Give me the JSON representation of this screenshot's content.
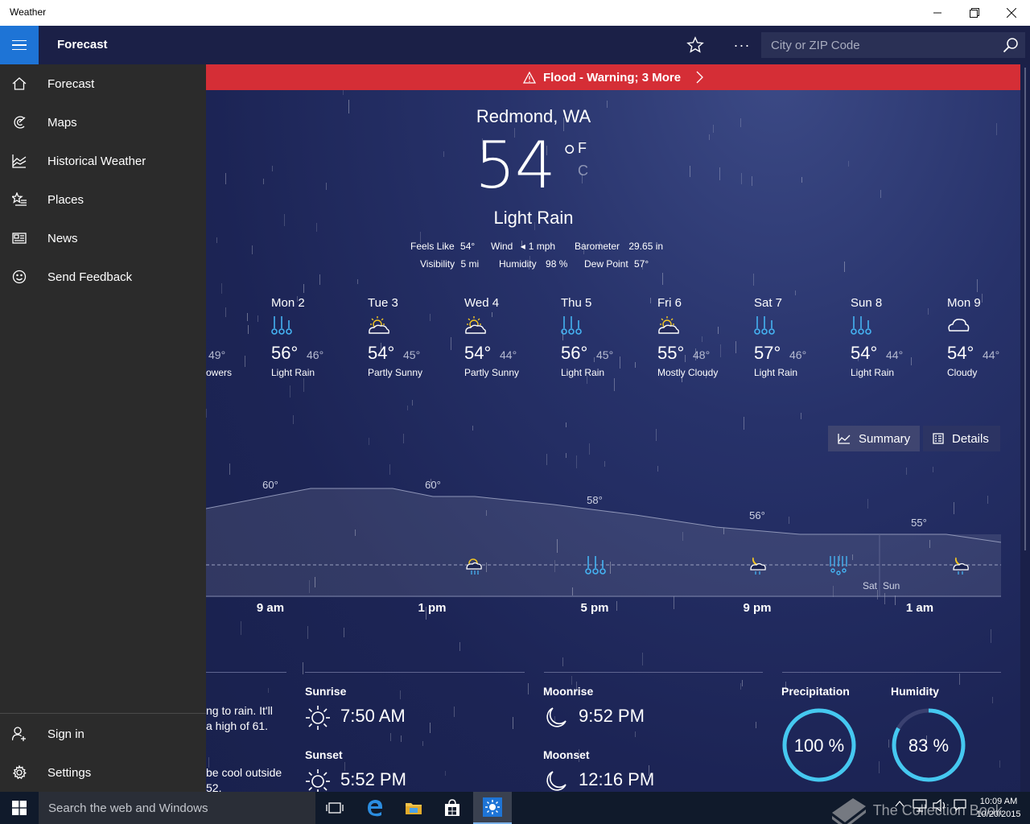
{
  "window": {
    "title": "Weather"
  },
  "appbar": {
    "section_title": "Forecast",
    "search_placeholder": "City or ZIP Code",
    "more_label": "···"
  },
  "nav": {
    "items": [
      {
        "label": "Forecast",
        "icon": "home-icon"
      },
      {
        "label": "Maps",
        "icon": "map-icon"
      },
      {
        "label": "Historical Weather",
        "icon": "chart-icon"
      },
      {
        "label": "Places",
        "icon": "star-list-icon"
      },
      {
        "label": "News",
        "icon": "news-icon"
      },
      {
        "label": "Send Feedback",
        "icon": "smiley-icon"
      }
    ],
    "footer": [
      {
        "label": "Sign in",
        "icon": "person-add-icon"
      },
      {
        "label": "Settings",
        "icon": "gear-icon"
      }
    ]
  },
  "alert": {
    "text": "Flood - Warning; 3 More"
  },
  "current": {
    "location": "Redmond, WA",
    "temp": "54",
    "degree": "°",
    "unit_f": "F",
    "unit_c": "C",
    "condition": "Light Rain",
    "feels_like_label": "Feels Like",
    "feels_like": "54°",
    "wind_label": "Wind",
    "wind": "1 mph",
    "barometer_label": "Barometer",
    "barometer": "29.65 in",
    "visibility_label": "Visibility",
    "visibility": "5 mi",
    "humidity_label": "Humidity",
    "humidity": "98 %",
    "dewpoint_label": "Dew Point",
    "dewpoint": "57°"
  },
  "daily": {
    "partial": {
      "lo": "49°",
      "cond": "owers"
    },
    "days": [
      {
        "name": "Mon 2",
        "hi": "56°",
        "lo": "46°",
        "cond": "Light Rain",
        "icon": "rain"
      },
      {
        "name": "Tue 3",
        "hi": "54°",
        "lo": "45°",
        "cond": "Partly Sunny",
        "icon": "partly-sunny"
      },
      {
        "name": "Wed 4",
        "hi": "54°",
        "lo": "44°",
        "cond": "Partly Sunny",
        "icon": "partly-sunny"
      },
      {
        "name": "Thu 5",
        "hi": "56°",
        "lo": "45°",
        "cond": "Light Rain",
        "icon": "rain"
      },
      {
        "name": "Fri 6",
        "hi": "55°",
        "lo": "48°",
        "cond": "Mostly Cloudy",
        "icon": "partly-sunny"
      },
      {
        "name": "Sat 7",
        "hi": "57°",
        "lo": "46°",
        "cond": "Light Rain",
        "icon": "rain"
      },
      {
        "name": "Sun 8",
        "hi": "54°",
        "lo": "44°",
        "cond": "Light Rain",
        "icon": "rain"
      },
      {
        "name": "Mon 9",
        "hi": "54°",
        "lo": "44°",
        "cond": "Cloudy",
        "icon": "cloud"
      }
    ]
  },
  "view_toggle": {
    "summary": "Summary",
    "details": "Details"
  },
  "hourly": {
    "temps": [
      "60°",
      "60°",
      "58°",
      "56°",
      "55°"
    ],
    "times": [
      "9 am",
      "1 pm",
      "5 pm",
      "9 pm",
      "1 am"
    ],
    "day_labels": [
      "Sat",
      "Sun"
    ]
  },
  "summary": {
    "line1": "ng to rain. It'll",
    "line2": "a high of 61.",
    "line3": "be cool outside",
    "line4": "52."
  },
  "sun_moon": {
    "sunrise_label": "Sunrise",
    "sunrise": "7:50 AM",
    "sunset_label": "Sunset",
    "sunset": "5:52 PM",
    "moonrise_label": "Moonrise",
    "moonrise": "9:52 PM",
    "moonset_label": "Moonset",
    "moonset": "12:16 PM"
  },
  "rings": {
    "precip_label": "Precipitation",
    "precip": "100 %",
    "precip_value": 100,
    "humidity_label": "Humidity",
    "humidity": "83 %",
    "humidity_value": 83,
    "ring_color": "#45c8f0"
  },
  "taskbar": {
    "search_placeholder": "Search the web and Windows",
    "time": "10:09 AM",
    "date": "10/20/2015"
  },
  "watermark": "The Collection Book",
  "colors": {
    "accent": "#1e74d6",
    "alert": "#d52e36",
    "rain_icon": "#45b3f2",
    "sun_icon": "#f3c623"
  }
}
